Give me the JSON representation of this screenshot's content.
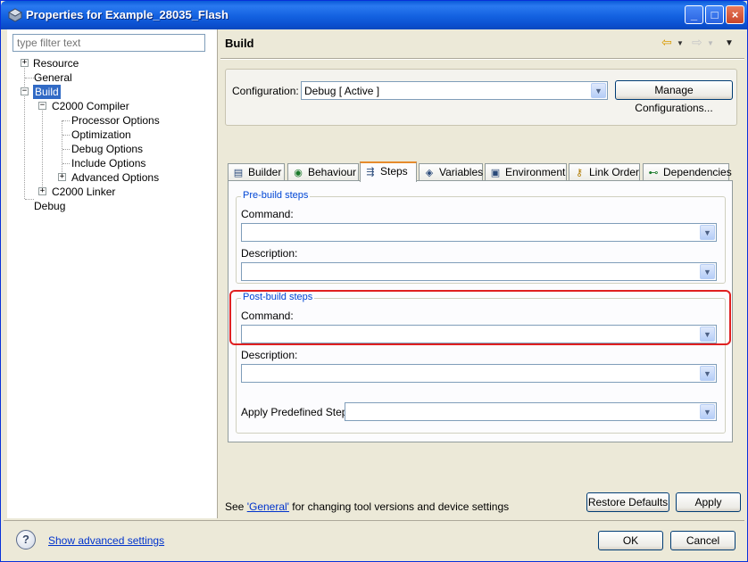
{
  "window": {
    "title": "Properties for Example_28035_Flash",
    "minimize": "_",
    "maximize": "□",
    "close": "×"
  },
  "filter": {
    "placeholder": "type filter text"
  },
  "tree": {
    "resource": "Resource",
    "general": "General",
    "build": "Build",
    "compiler": "C2000 Compiler",
    "processor_options": "Processor Options",
    "optimization": "Optimization",
    "debug_options": "Debug Options",
    "include_options": "Include Options",
    "advanced_options": "Advanced Options",
    "linker": "C2000 Linker",
    "debug": "Debug"
  },
  "page": {
    "title": "Build"
  },
  "configuration": {
    "label": "Configuration:",
    "value": "Debug  [ Active ]",
    "manage_button": "Manage Configurations..."
  },
  "tabs": [
    "Builder",
    "Behaviour",
    "Steps",
    "Variables",
    "Environment",
    "Link Order",
    "Dependencies"
  ],
  "prebuild": {
    "title": "Pre-build steps",
    "command_label": "Command:",
    "command_value": "",
    "description_label": "Description:",
    "description_value": ""
  },
  "postbuild": {
    "title": "Post-build steps",
    "command_label": "Command:",
    "command_value": "",
    "description_label": "Description:",
    "description_value": ""
  },
  "predefined": {
    "label": "Apply Predefined Step:",
    "value": ""
  },
  "footer": {
    "see_prefix": "See ",
    "see_link": "'General'",
    "see_suffix": " for changing tool versions and device settings"
  },
  "buttons": {
    "restore_defaults": "Restore Defaults",
    "apply": "Apply",
    "ok": "OK",
    "cancel": "Cancel"
  },
  "advanced_link": "Show advanced settings",
  "colors": {
    "selection": "#316ac5",
    "group_title": "#0046d5",
    "highlight": "#e02020",
    "tab_active_accent": "#e68b2c"
  }
}
